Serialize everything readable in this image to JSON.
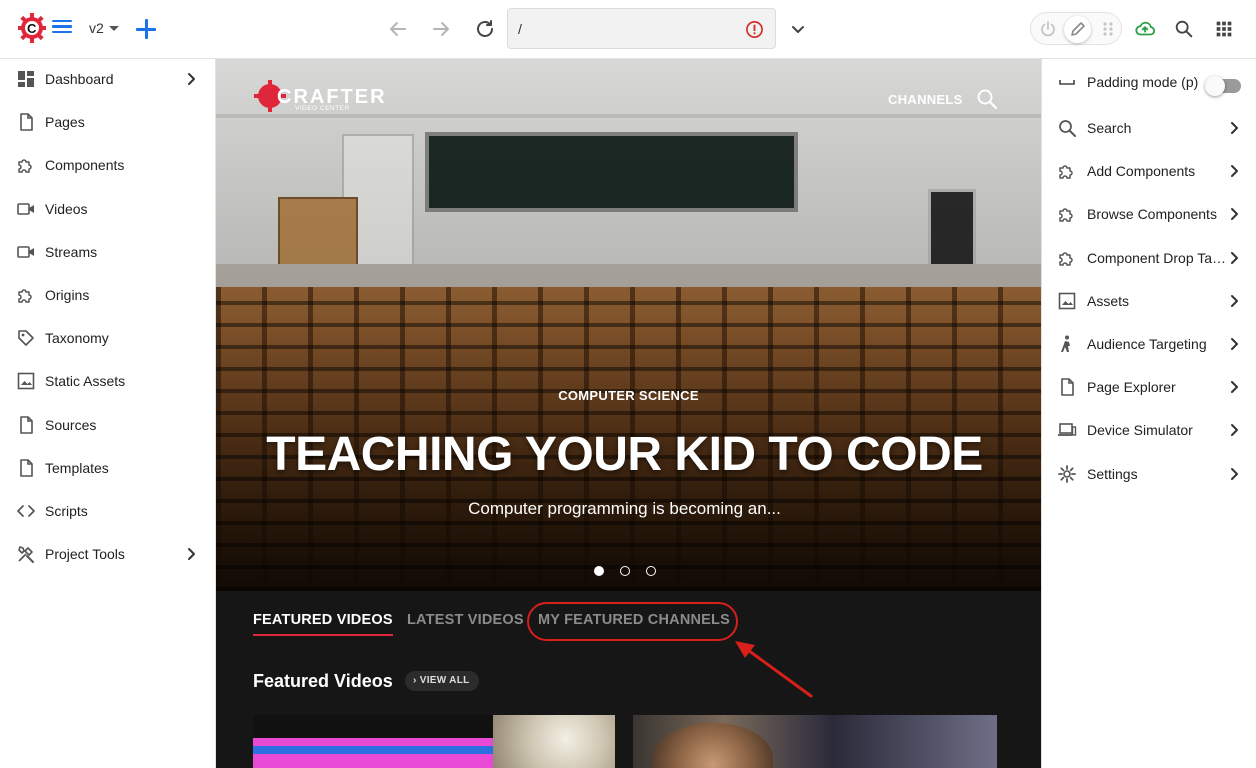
{
  "toolbar": {
    "site": "v2",
    "address": "/",
    "colors": {
      "accent": "#1a73e8",
      "logo_red": "#e0263b",
      "error": "#d32f2f",
      "publish_green": "#2e9e4a"
    }
  },
  "sidebar": {
    "items": [
      {
        "label": "Dashboard",
        "icon": "dashboard-icon",
        "has_chevron": true
      },
      {
        "label": "Pages",
        "icon": "page-icon",
        "has_chevron": false
      },
      {
        "label": "Components",
        "icon": "puzzle-icon",
        "has_chevron": false
      },
      {
        "label": "Videos",
        "icon": "video-icon",
        "has_chevron": false
      },
      {
        "label": "Streams",
        "icon": "video-icon",
        "has_chevron": false
      },
      {
        "label": "Origins",
        "icon": "puzzle-icon",
        "has_chevron": false
      },
      {
        "label": "Taxonomy",
        "icon": "tag-icon",
        "has_chevron": false
      },
      {
        "label": "Static Assets",
        "icon": "image-icon",
        "has_chevron": false
      },
      {
        "label": "Sources",
        "icon": "page-icon",
        "has_chevron": false
      },
      {
        "label": "Templates",
        "icon": "page-icon",
        "has_chevron": false
      },
      {
        "label": "Scripts",
        "icon": "code-icon",
        "has_chevron": false
      },
      {
        "label": "Project Tools",
        "icon": "tools-icon",
        "has_chevron": true
      }
    ]
  },
  "preview": {
    "logo_text": "CRAFTER",
    "logo_subtext": "VIDEO CENTER",
    "nav_label": "CHANNELS",
    "hero": {
      "category": "COMPUTER SCIENCE",
      "title": "TEACHING YOUR KID TO CODE",
      "description": "Computer programming is becoming an...",
      "slide_count": 3,
      "active_slide": 1
    },
    "tabs": [
      "FEATURED VIDEOS",
      "LATEST VIDEOS",
      "MY FEATURED CHANNELS"
    ],
    "active_tab": 0,
    "section_title": "Featured Videos",
    "view_all": "VIEW ALL"
  },
  "tools_panel": {
    "padding_mode": {
      "label": "Padding mode (p)",
      "enabled": false
    },
    "items": [
      {
        "label": "Search",
        "icon": "search-icon"
      },
      {
        "label": "Add Components",
        "icon": "puzzle-icon"
      },
      {
        "label": "Browse Components",
        "icon": "puzzle-icon"
      },
      {
        "label": "Component Drop Ta…",
        "icon": "puzzle-icon"
      },
      {
        "label": "Assets",
        "icon": "image-icon"
      },
      {
        "label": "Audience Targeting",
        "icon": "person-icon"
      },
      {
        "label": "Page Explorer",
        "icon": "page-icon"
      },
      {
        "label": "Device Simulator",
        "icon": "devices-icon"
      },
      {
        "label": "Settings",
        "icon": "gear-icon"
      }
    ]
  }
}
